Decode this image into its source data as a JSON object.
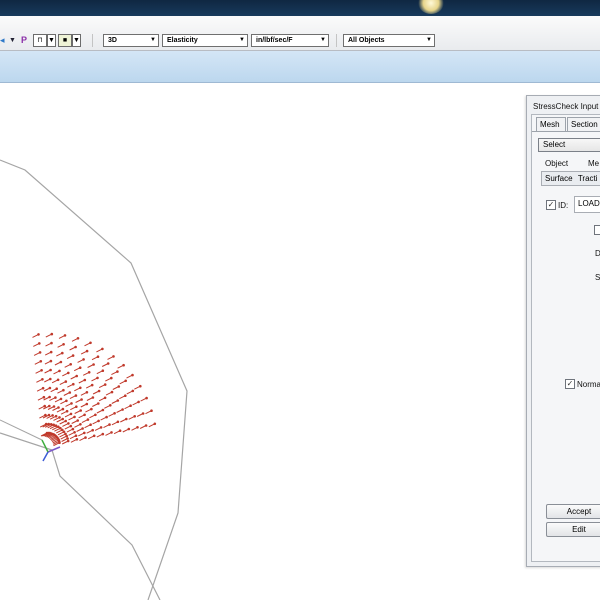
{
  "toolbar": {
    "pen_glyph": "P",
    "dimension_select": "3D",
    "analysis_select": "Elasticity",
    "units_select": "in/lbf/sec/F",
    "objects_select": "All Objects",
    "dropdown_arrow": "▼"
  },
  "panel": {
    "title": "StressCheck Input",
    "tabs": [
      "Mesh",
      "Section"
    ],
    "action_select": "Select",
    "object_header": "Object",
    "method_header": "Me",
    "object_value": "Surface",
    "method_value": "Tracti",
    "id_checkbox": {
      "checked": true,
      "label": "ID:"
    },
    "id_value": "LOAD",
    "label_d": "D",
    "label_s": "S",
    "normal_checkbox": {
      "checked": true,
      "label": "Norma"
    },
    "accept_button": "Accept",
    "edit_button": "Edit"
  },
  "colors": {
    "title_bar": "#0f2742",
    "toolbar_bg": "#e9ebee",
    "ribbon_band": "#c8dff2",
    "viewport_bg": "#ffffff",
    "outline_stroke": "#9a9a9a",
    "load_arrows": "#c0392b",
    "axis_x": "#7a58c8",
    "axis_y": "#3fae3f",
    "axis_z": "#3b5bd6"
  }
}
